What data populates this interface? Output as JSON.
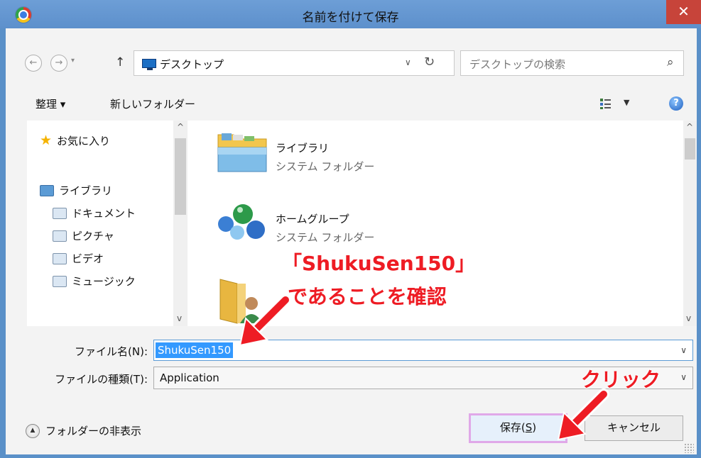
{
  "window": {
    "title": "名前を付けて保存",
    "close_glyph": "✕"
  },
  "address": {
    "location": "デスクトップ",
    "search_placeholder": "デスクトップの検索"
  },
  "toolbar": {
    "organize_label": "整理 ▾",
    "new_folder_label": "新しいフォルダー",
    "help_glyph": "?"
  },
  "nav": {
    "favorites": "お気に入り",
    "libraries": "ライブラリ",
    "items": [
      "ドキュメント",
      "ピクチャ",
      "ビデオ",
      "ミュージック"
    ]
  },
  "content": {
    "items": [
      {
        "name": "ライブラリ",
        "type": "システム フォルダー",
        "icon": "library-folder-icon"
      },
      {
        "name": "ホームグループ",
        "type": "システム フォルダー",
        "icon": "homegroup-icon"
      },
      {
        "name": "",
        "type": "",
        "icon": "user-folder-icon"
      }
    ]
  },
  "fields": {
    "filename_label": "ファイル名(N):",
    "filename_value": "ShukuSen150",
    "filetype_label": "ファイルの種類(T):",
    "filetype_value": "Application"
  },
  "footer": {
    "hide_folders_label": "フォルダーの非表示",
    "save_label": "保存(",
    "save_key": "S",
    "save_close": ")",
    "cancel_label": "キャンセル"
  },
  "annotations": {
    "line1": "「ShukuSen150」",
    "line2": "であることを確認",
    "click": "クリック"
  },
  "colors": {
    "titlebar": "#5d90cc",
    "close": "#c7443a",
    "annotation": "#ee1c24",
    "selection": "#3399ff"
  }
}
